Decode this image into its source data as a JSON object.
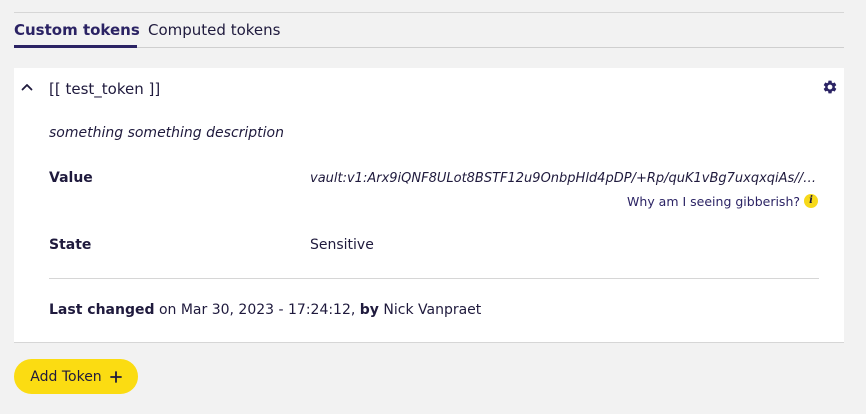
{
  "tabs": [
    {
      "label": "Custom tokens",
      "active": true
    },
    {
      "label": "Computed tokens",
      "active": false
    }
  ],
  "token": {
    "name": "[[ test_token ]]",
    "description": "something something description",
    "value_label": "Value",
    "value": "vault:v1:Arx9iQNF8ULot8BSTF12u9OnbpHld4pDP/+Rp/quK1vBg7uxqxqiAs//K...",
    "gibberish_link": "Why am I seeing gibberish?",
    "state_label": "State",
    "state_value": "Sensitive",
    "last_changed_label": "Last changed",
    "last_changed_on": " on Mar 30, 2023 - 17:24:12, ",
    "by_label": "by",
    "author": " Nick Vanpraet",
    "icons": {
      "collapse": "chevron-up-icon",
      "settings": "gear-icon",
      "info": "info-icon"
    }
  },
  "actions": {
    "add_token_label": "Add Token",
    "add_icon": "plus-icon"
  },
  "colors": {
    "accent": "#2b2364",
    "button_yellow": "#fbdc12",
    "background": "#f2f2f2"
  }
}
